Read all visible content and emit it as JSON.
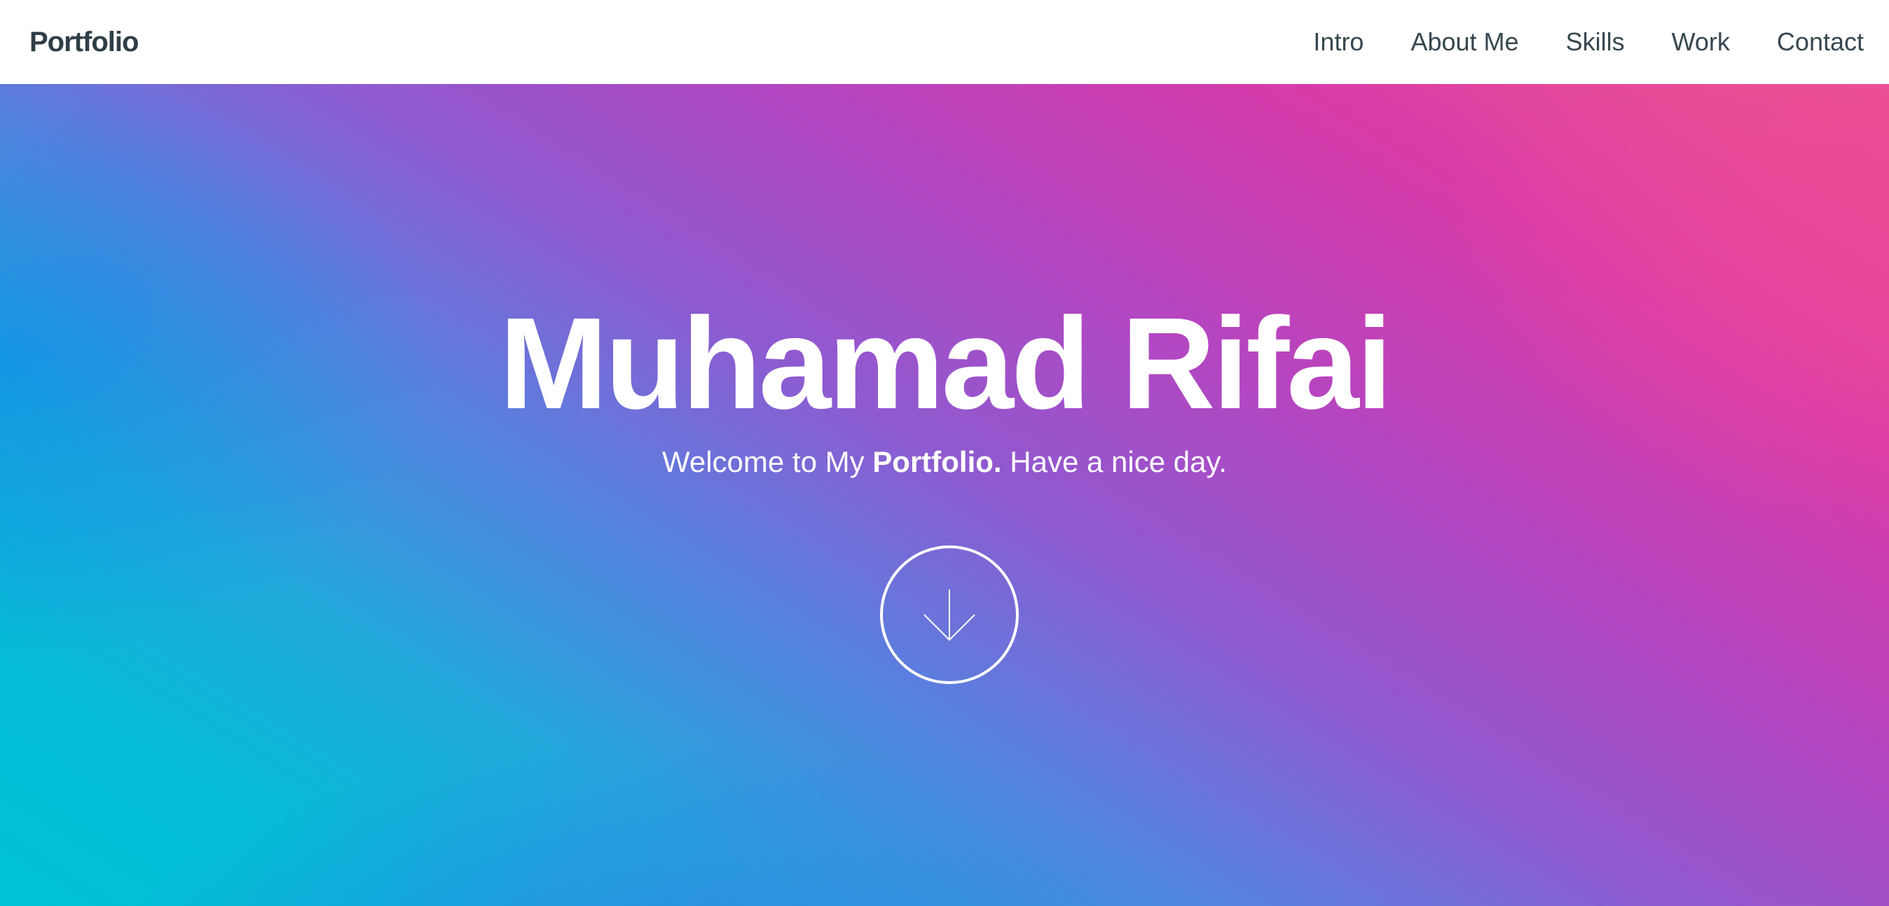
{
  "brand": {
    "label": "Portfolio"
  },
  "nav": {
    "items": [
      {
        "label": "Intro"
      },
      {
        "label": "About Me"
      },
      {
        "label": "Skills"
      },
      {
        "label": "Work"
      },
      {
        "label": "Contact"
      }
    ]
  },
  "hero": {
    "title": "Muhamad Rifai",
    "subtitle_prefix": "Welcome to My ",
    "subtitle_bold": "Portfolio.",
    "subtitle_suffix": " Have a nice day.",
    "scroll_icon": "arrow-down-icon"
  },
  "colors": {
    "navbar_bg": "#ffffff",
    "nav_text": "#37474f",
    "brand_text": "#2f3e46",
    "gradient": [
      "#00c2d4",
      "#23a8dc",
      "#8f5ad0",
      "#d93ba8",
      "#ea5a8c"
    ],
    "hero_text": "#ffffff"
  }
}
